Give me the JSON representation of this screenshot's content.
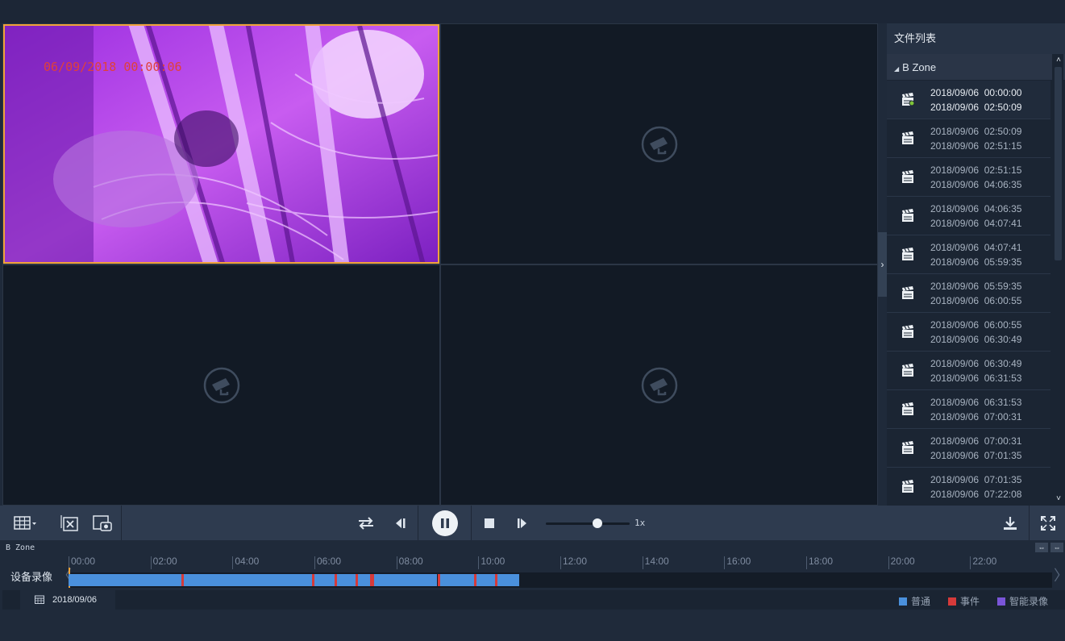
{
  "video": {
    "osd_timestamp": "06/09/2018 00:00:06",
    "placeholder_icon": "camera-icon"
  },
  "file_panel": {
    "title": "文件列表",
    "zone": "B Zone",
    "files": [
      {
        "date1": "2018/09/06",
        "time1": "00:00:00",
        "date2": "2018/09/06",
        "time2": "02:50:09",
        "active": true
      },
      {
        "date1": "2018/09/06",
        "time1": "02:50:09",
        "date2": "2018/09/06",
        "time2": "02:51:15"
      },
      {
        "date1": "2018/09/06",
        "time1": "02:51:15",
        "date2": "2018/09/06",
        "time2": "04:06:35"
      },
      {
        "date1": "2018/09/06",
        "time1": "04:06:35",
        "date2": "2018/09/06",
        "time2": "04:07:41"
      },
      {
        "date1": "2018/09/06",
        "time1": "04:07:41",
        "date2": "2018/09/06",
        "time2": "05:59:35"
      },
      {
        "date1": "2018/09/06",
        "time1": "05:59:35",
        "date2": "2018/09/06",
        "time2": "06:00:55"
      },
      {
        "date1": "2018/09/06",
        "time1": "06:00:55",
        "date2": "2018/09/06",
        "time2": "06:30:49"
      },
      {
        "date1": "2018/09/06",
        "time1": "06:30:49",
        "date2": "2018/09/06",
        "time2": "06:31:53"
      },
      {
        "date1": "2018/09/06",
        "time1": "06:31:53",
        "date2": "2018/09/06",
        "time2": "07:00:31"
      },
      {
        "date1": "2018/09/06",
        "time1": "07:00:31",
        "date2": "2018/09/06",
        "time2": "07:01:35"
      },
      {
        "date1": "2018/09/06",
        "time1": "07:01:35",
        "date2": "2018/09/06",
        "time2": "07:22:08"
      }
    ]
  },
  "controls": {
    "speed": "1x"
  },
  "timeline": {
    "zone": "B Zone",
    "label": "设备录像",
    "ticks": [
      "00:00",
      "02:00",
      "04:00",
      "06:00",
      "08:00",
      "10:00",
      "12:00",
      "14:00",
      "16:00",
      "18:00",
      "20:00",
      "22:00"
    ],
    "recording_segments_hours": [
      [
        0,
        2.75
      ],
      [
        2.8,
        5.95
      ],
      [
        6.0,
        6.5
      ],
      [
        6.55,
        7.0
      ],
      [
        7.05,
        7.35
      ],
      [
        7.45,
        9.0
      ],
      [
        9.05,
        9.9
      ],
      [
        9.95,
        10.4
      ],
      [
        10.45,
        11.0
      ]
    ],
    "event_marks_hours": [
      2.77,
      5.97,
      6.52,
      7.02,
      7.38,
      7.42,
      9.02,
      9.92,
      10.42
    ],
    "date": "2018/09/06"
  },
  "legend": [
    {
      "label": "普通",
      "color": "#4a90dc"
    },
    {
      "label": "事件",
      "color": "#d63a3a"
    },
    {
      "label": "智能录像",
      "color": "#7a55d8"
    }
  ]
}
